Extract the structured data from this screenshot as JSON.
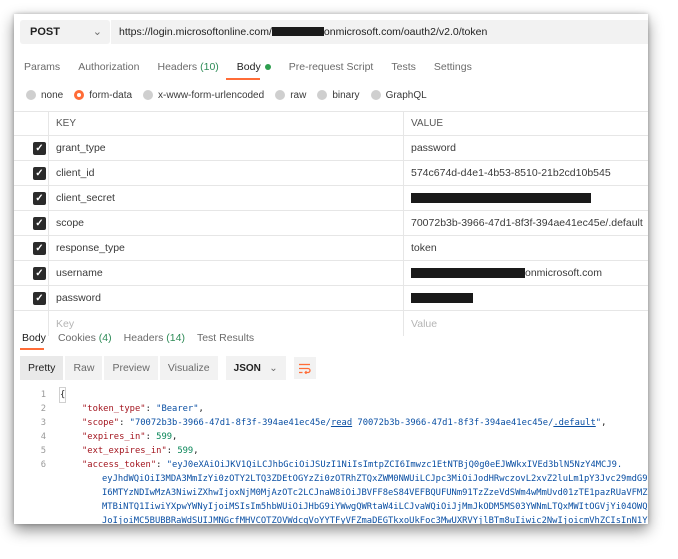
{
  "request": {
    "method": "POST",
    "url_prefix": "https://login.microsoftonline.com/",
    "url_suffix": "onmicrosoft.com/oauth2/v2.0/token"
  },
  "request_tabs": [
    {
      "label": "Params"
    },
    {
      "label": "Authorization"
    },
    {
      "label": "Headers",
      "count": "(10)"
    },
    {
      "label": "Body"
    },
    {
      "label": "Pre-request Script"
    },
    {
      "label": "Tests"
    },
    {
      "label": "Settings"
    }
  ],
  "body_types": [
    "none",
    "form-data",
    "x-www-form-urlencoded",
    "raw",
    "binary",
    "GraphQL"
  ],
  "body_type_selected": "form-data",
  "table": {
    "key_header": "KEY",
    "value_header": "VALUE",
    "rows": [
      {
        "key": "grant_type",
        "value": "password",
        "checked": true
      },
      {
        "key": "client_id",
        "value": "574c674d-d4e1-4b53-8510-21b2cd10b545",
        "checked": true
      },
      {
        "key": "client_secret",
        "value": "",
        "redacted": true,
        "checked": true
      },
      {
        "key": "scope",
        "value": "70072b3b-3966-47d1-8f3f-394ae41ec45e/.default",
        "checked": true
      },
      {
        "key": "response_type",
        "value": "token",
        "checked": true
      },
      {
        "key": "username",
        "value": "onmicrosoft.com",
        "redacted_prefix": true,
        "checked": true
      },
      {
        "key": "password",
        "value": "",
        "redacted": true,
        "checked": true
      }
    ],
    "placeholder_key": "Key",
    "placeholder_value": "Value"
  },
  "response_tabs": [
    {
      "label": "Body"
    },
    {
      "label": "Cookies",
      "count": "(4)"
    },
    {
      "label": "Headers",
      "count": "(14)"
    },
    {
      "label": "Test Results"
    }
  ],
  "response_views": [
    "Pretty",
    "Raw",
    "Preview",
    "Visualize"
  ],
  "response_format": "JSON",
  "code_lines": [
    {
      "n": "1",
      "text": "{"
    },
    {
      "n": "2",
      "key": "\"token_type\"",
      "val": "\"Bearer\""
    },
    {
      "n": "3",
      "key": "\"scope\"",
      "val_a": "\"70072b3b-3966-47d1-8f3f-394ae41ec45e/",
      "val_b": "read",
      "val_c": " 70072b3b-3966-47d1-8f3f-394ae41ec45e/",
      "val_d": ".default",
      "val_e": "\""
    },
    {
      "n": "4",
      "key": "\"expires_in\"",
      "num": "599"
    },
    {
      "n": "5",
      "key": "\"ext_expires_in\"",
      "num": "599"
    },
    {
      "n": "6",
      "key": "\"access_token\"",
      "val": "\"eyJ0eXAiOiJKV1QiLCJhbGciOiJSUzI1NiIsImtpZCI6Imwzc1EtNTBjQ0g0eEJWWkxIVEd3blN5NzY4MCJ9."
    }
  ],
  "token_continuation": [
    "eyJhdWQiOiI3MDA3MmIzYi0zOTY2LTQ3ZDEtOGYzZi0zOTRhZTQxZWM0NWUiLCJpc3MiOiJodHRwczovL2xvZ2luLm1pY3Jvc29mdG9ubGluZ",
    "I6MTYzNDIwMzA3NiwiZXhwIjoxNjM0MjAzOTc2LCJnaW8iOiJBVFF8eS84VEFBQUFUNm91TzZzeVdSWm4wMmUvd01zTE1pazRUaVFMZ2Jxa2I",
    "MTBiNTQ1IiwiYXpwYWNyIjoiMSIsIm5hbWUiOiJHbG9iYWwgQWRtaW4iLCJvaWQiOiJjMmJkODM5MS03YWNmLTQxMWItOGVjYi04OWQyOGZk",
    "JoIjoiMC5BUBBRaWdSUIJMNGcfMHVCOTZOVWdcgVoYYTFyVFZmaDEGTkxoUkFoc3MwUXRVYjlBTm8uIiwic2NwIjoicmVhZCIsInN1YiI6IjE"
  ]
}
